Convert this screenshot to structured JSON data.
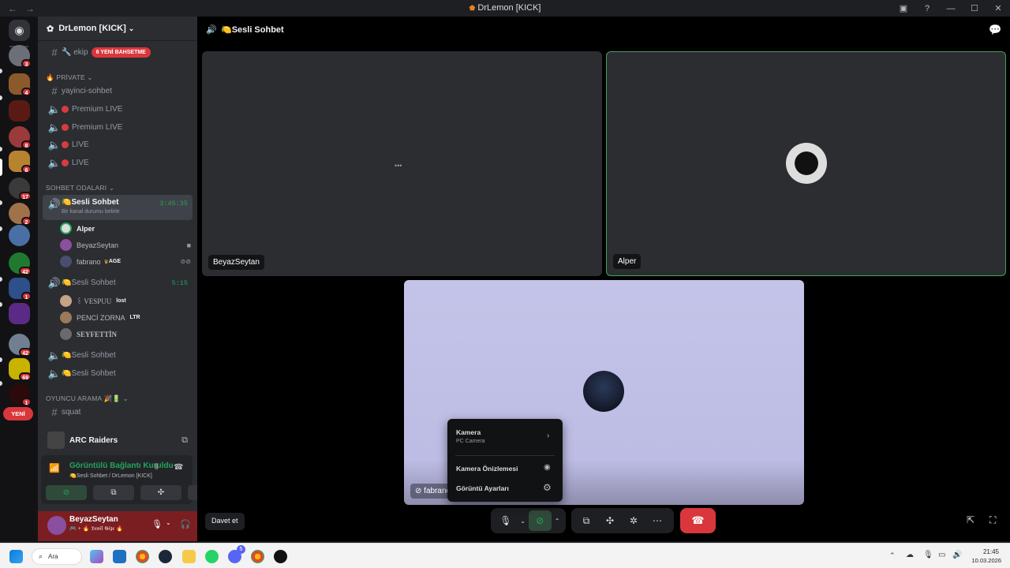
{
  "window": {
    "title": "DrLemon [KICK]",
    "back": "←",
    "forward": "→"
  },
  "rail": {
    "guild_badges": [
      "3",
      "4",
      "8",
      "6",
      "17",
      "2",
      "42",
      "1",
      "42",
      "69",
      "1"
    ],
    "new_label": "YENİ"
  },
  "sidebar": {
    "server_name": "DrLemon [KICK]",
    "channels_top": [
      {
        "name": "🔧 ekip",
        "badge": "6 YENİ BAHSETME"
      }
    ],
    "categories": {
      "private": "🔥 PRİVATE",
      "rooms": "SOHBET ODALARI",
      "search": "OYUNCU ARAMA 🎉🔋"
    },
    "private_channels": [
      {
        "name": "yayinci-sohbet",
        "type": "text"
      },
      {
        "name": "Premium LIVE",
        "type": "voice"
      },
      {
        "name": "Premium LIVE",
        "type": "voice"
      },
      {
        "name": "LIVE",
        "type": "voice"
      },
      {
        "name": "LIVE",
        "type": "voice"
      }
    ],
    "active_voice": {
      "name": "🍋Sesli Sohbet",
      "timer": "3:45:35",
      "status": "Bir kanal durumu belirle"
    },
    "active_users": [
      {
        "name": "Alper",
        "tag": ""
      },
      {
        "name": "BeyazSeytan",
        "tag": ""
      },
      {
        "name": "fabrano",
        "tag": "AGE"
      }
    ],
    "voice2": {
      "name": "🍋Sesli Sohbet",
      "timer": "5:15"
    },
    "voice2_users": [
      {
        "name": "꒰ VESPUU",
        "tag": "lost"
      },
      {
        "name": "PENCİ ZORNA",
        "tag": "LTR"
      },
      {
        "name": "SEYFETTİN",
        "tag": ""
      }
    ],
    "voice3": "🍋Sesli Sohbet",
    "voice4": "🍋Sesli Sohbet",
    "search_channel": "squat",
    "activity": {
      "game": "ARC Raiders"
    },
    "connection": {
      "status": "Görüntülü Bağlantı Kuruldu",
      "location": "🍋Sesli Sohbet / DrLemon [KICK]"
    },
    "me": {
      "name": "BeyazSeytan",
      "status": "🎮 + 🔥 𝕯𝖊𝖛𝖎𝖑 𝕲𝖎𝖟𝖊 🔥"
    }
  },
  "main": {
    "channel_title": "🍋Sesli Sohbet",
    "tiles": [
      {
        "name": "BeyazSeytan"
      },
      {
        "name": "Alper"
      },
      {
        "name": "fabrano"
      }
    ],
    "invite_label": "Davet et",
    "camera_menu": {
      "camera_label": "Kamera",
      "camera_device": "PC Camera",
      "preview_label": "Kamera Önizlemesi",
      "video_settings_label": "Görüntü Ayarları"
    }
  },
  "taskbar": {
    "search_label": "Ara",
    "time": "21:45",
    "date": "10.03.2026",
    "discord_badge": "5"
  },
  "colors": {
    "accent_green": "#23a55a",
    "danger": "#da373c",
    "active_border": "#3ba55d",
    "brand": "#5865f2"
  }
}
